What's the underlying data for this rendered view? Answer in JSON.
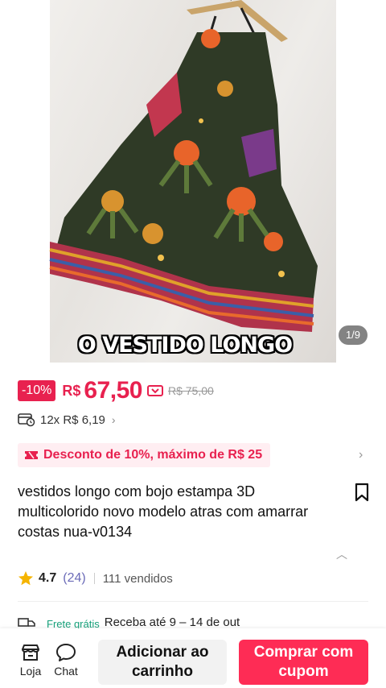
{
  "hero": {
    "image_alt": "colorful printed long dress on hanger",
    "pager": "1/9",
    "caption": "O VESTIDO LONGO"
  },
  "price": {
    "discount_badge": "-10%",
    "currency": "R$",
    "value": "67,50",
    "old_price": "R$ 75,00",
    "installments": "12x R$ 6,19",
    "accent_color": "#e8214f"
  },
  "banner": {
    "text": "Desconto de 10%, máximo de R$ 25"
  },
  "product": {
    "title": "vestidos longo com bojo estampa 3D multicolorido novo modelo atras com amarrar costas nua-v0134"
  },
  "rating": {
    "score": "4.7",
    "count": "(24)",
    "sold": "111 vendidos"
  },
  "shipping": {
    "free_label": "Frete grátis",
    "receive_text": "Receba até 9 – 14 de out"
  },
  "bottom_bar": {
    "store_label": "Loja",
    "chat_label": "Chat",
    "add_to_cart": "Adicionar ao carrinho",
    "buy_with_coupon": "Comprar com cupom",
    "buy_color": "#fe2c55"
  }
}
